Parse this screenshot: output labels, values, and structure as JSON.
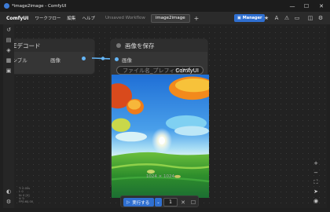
{
  "window": {
    "title": "*image2image - ComfyUI",
    "minimize": "—",
    "maximize": "☐",
    "close": "✕"
  },
  "menubar": {
    "logo": "ComfyUI",
    "menus": [
      "ワークフロー",
      "編集",
      "ヘルプ"
    ],
    "tabs": [
      {
        "label": "Unsaved Workflow",
        "active": false
      },
      {
        "label": "image2image",
        "active": true
      }
    ],
    "new_tab": "+",
    "manager_label": "Manager"
  },
  "nodes": {
    "vae_decode": {
      "title": "VAEデコード",
      "input_label": "サンプル",
      "output_label": "画像"
    },
    "save_image": {
      "title": "画像を保存",
      "input_label": "画像",
      "filename_prefix": {
        "placeholder": "ファイル名_プレフィックス",
        "value": "ComfyUI"
      },
      "image_caption": "1024 × 1024"
    }
  },
  "stats": [
    "T: 0.00s",
    "I: 0",
    "N: 0 [0]",
    "V: 0",
    "FPS:60.00"
  ],
  "runbar": {
    "run_label": "実行する",
    "queue_count": "1"
  }
}
